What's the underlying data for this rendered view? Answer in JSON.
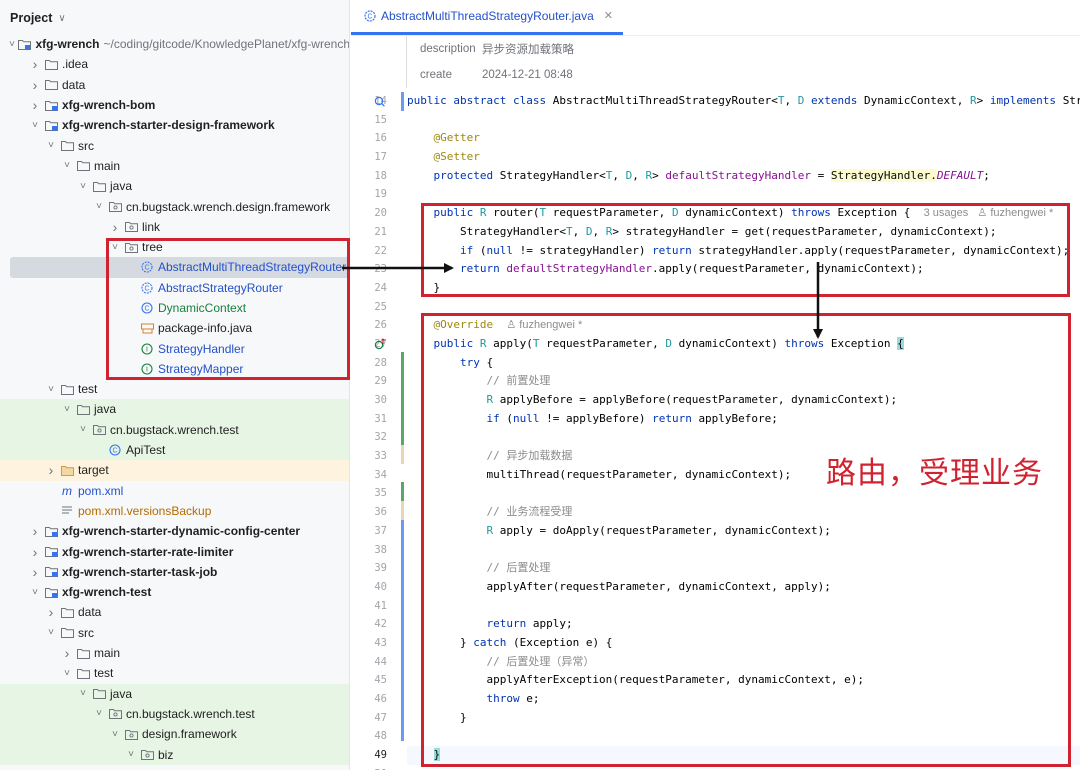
{
  "project": {
    "title": "Project",
    "tree": [
      {
        "indent": 0,
        "arrow": "down",
        "icon": "module-folder-icon",
        "label": "xfg-wrench",
        "bold": true,
        "path": "~/coding/gitcode/KnowledgePlanet/xfg-wrench"
      },
      {
        "indent": 1,
        "arrow": "right",
        "icon": "folder-icon",
        "label": ".idea"
      },
      {
        "indent": 1,
        "arrow": "right",
        "icon": "folder-icon",
        "label": "data"
      },
      {
        "indent": 1,
        "arrow": "right",
        "icon": "module-folder-icon",
        "label": "xfg-wrench-bom",
        "bold": true
      },
      {
        "indent": 1,
        "arrow": "down",
        "icon": "module-folder-icon",
        "label": "xfg-wrench-starter-design-framework",
        "bold": true
      },
      {
        "indent": 2,
        "arrow": "down",
        "icon": "folder-icon",
        "label": "src"
      },
      {
        "indent": 3,
        "arrow": "down",
        "icon": "folder-icon",
        "label": "main"
      },
      {
        "indent": 4,
        "arrow": "down",
        "icon": "folder-icon",
        "label": "java"
      },
      {
        "indent": 5,
        "arrow": "down",
        "icon": "package-icon",
        "label": "cn.bugstack.wrench.design.framework"
      },
      {
        "indent": 6,
        "arrow": "right",
        "icon": "package-icon",
        "label": "link"
      },
      {
        "indent": 6,
        "arrow": "down",
        "icon": "package-icon",
        "label": "tree"
      },
      {
        "indent": 7,
        "arrow": "",
        "icon": "abstract-class-icon",
        "label": "AbstractMultiThreadStrategyRouter",
        "color": "blue",
        "selected": true
      },
      {
        "indent": 7,
        "arrow": "",
        "icon": "abstract-class-icon",
        "label": "AbstractStrategyRouter",
        "color": "blue"
      },
      {
        "indent": 7,
        "arrow": "",
        "icon": "class-icon",
        "label": "DynamicContext",
        "color": "green"
      },
      {
        "indent": 7,
        "arrow": "",
        "icon": "package-info-icon",
        "label": "package-info.java"
      },
      {
        "indent": 7,
        "arrow": "",
        "icon": "interface-icon",
        "label": "StrategyHandler",
        "color": "blue"
      },
      {
        "indent": 7,
        "arrow": "",
        "icon": "interface-icon",
        "label": "StrategyMapper",
        "color": "blue"
      },
      {
        "indent": 2,
        "arrow": "down",
        "icon": "folder-icon",
        "label": "test"
      },
      {
        "indent": 3,
        "arrow": "down",
        "icon": "folder-icon",
        "label": "java",
        "hl": "green"
      },
      {
        "indent": 4,
        "arrow": "down",
        "icon": "package-icon",
        "label": "cn.bugstack.wrench.test",
        "hl": "green"
      },
      {
        "indent": 5,
        "arrow": "",
        "icon": "class-icon",
        "label": "ApiTest",
        "hl": "green"
      },
      {
        "indent": 2,
        "arrow": "right",
        "icon": "excluded-folder-icon",
        "label": "target",
        "hl": "yellow"
      },
      {
        "indent": 2,
        "arrow": "",
        "icon": "maven-icon",
        "label": "pom.xml",
        "color": "blue"
      },
      {
        "indent": 2,
        "arrow": "",
        "icon": "text-file-icon",
        "label": "pom.xml.versionsBackup",
        "color": "orange"
      },
      {
        "indent": 1,
        "arrow": "right",
        "icon": "module-folder-icon",
        "label": "xfg-wrench-starter-dynamic-config-center",
        "bold": true
      },
      {
        "indent": 1,
        "arrow": "right",
        "icon": "module-folder-icon",
        "label": "xfg-wrench-starter-rate-limiter",
        "bold": true
      },
      {
        "indent": 1,
        "arrow": "right",
        "icon": "module-folder-icon",
        "label": "xfg-wrench-starter-task-job",
        "bold": true
      },
      {
        "indent": 1,
        "arrow": "down",
        "icon": "module-folder-icon",
        "label": "xfg-wrench-test",
        "bold": true
      },
      {
        "indent": 2,
        "arrow": "right",
        "icon": "folder-icon",
        "label": "data"
      },
      {
        "indent": 2,
        "arrow": "down",
        "icon": "folder-icon",
        "label": "src"
      },
      {
        "indent": 3,
        "arrow": "right",
        "icon": "folder-icon",
        "label": "main"
      },
      {
        "indent": 3,
        "arrow": "down",
        "icon": "folder-icon",
        "label": "test"
      },
      {
        "indent": 4,
        "arrow": "down",
        "icon": "folder-icon",
        "label": "java",
        "hl": "green"
      },
      {
        "indent": 5,
        "arrow": "down",
        "icon": "package-icon",
        "label": "cn.bugstack.wrench.test",
        "hl": "green"
      },
      {
        "indent": 6,
        "arrow": "down",
        "icon": "package-icon",
        "label": "design.framework",
        "hl": "green"
      },
      {
        "indent": 7,
        "arrow": "down",
        "icon": "package-icon",
        "label": "biz",
        "hl": "green"
      }
    ]
  },
  "editor": {
    "tab_label": "AbstractMultiThreadStrategyRouter.java",
    "doc": [
      {
        "key": "description",
        "value": "异步资源加载策略"
      },
      {
        "key": "create",
        "value": "2024-12-21 08:48"
      }
    ],
    "current_line": 49,
    "lines": [
      {
        "n": 14,
        "g": "impl-icon",
        "seg": [
          [
            "kw",
            "public abstract class "
          ],
          [
            "ty",
            "AbstractMultiThreadStrategyRouter<"
          ],
          [
            "tp",
            "T"
          ],
          [
            "ty",
            ", "
          ],
          [
            "tp",
            "D"
          ],
          [
            "kw",
            " extends "
          ],
          [
            "ty",
            "DynamicContext, "
          ],
          [
            "tp",
            "R"
          ],
          [
            "ty",
            "> "
          ],
          [
            "kw",
            "implements "
          ],
          [
            "ty",
            "StrategyMapper"
          ]
        ]
      },
      {
        "n": 15,
        "seg": []
      },
      {
        "n": 16,
        "seg": [
          [
            "ty",
            "    "
          ],
          [
            "an",
            "@Getter"
          ]
        ]
      },
      {
        "n": 17,
        "seg": [
          [
            "ty",
            "    "
          ],
          [
            "an",
            "@Setter"
          ]
        ]
      },
      {
        "n": 18,
        "seg": [
          [
            "ty",
            "    "
          ],
          [
            "kw",
            "protected "
          ],
          [
            "ty",
            "StrategyHandler<"
          ],
          [
            "tp",
            "T"
          ],
          [
            "ty",
            ", "
          ],
          [
            "tp",
            "D"
          ],
          [
            "ty",
            ", "
          ],
          [
            "tp",
            "R"
          ],
          [
            "ty",
            "> "
          ],
          [
            "fld",
            "defaultStrategyHandler"
          ],
          [
            "ty",
            " = "
          ],
          [
            "hly",
            "StrategyHandler."
          ],
          [
            "st",
            "DEFAULT"
          ],
          [
            "ty",
            ";"
          ]
        ]
      },
      {
        "n": 19,
        "seg": []
      },
      {
        "n": 20,
        "seg": [
          [
            "ty",
            "    "
          ],
          [
            "kw",
            "public "
          ],
          [
            "tp",
            "R "
          ],
          [
            "ty",
            "router("
          ],
          [
            "tp",
            "T "
          ],
          [
            "ty",
            "requestParameter, "
          ],
          [
            "tp",
            "D "
          ],
          [
            "ty",
            "dynamicContext) "
          ],
          [
            "kw",
            "throws "
          ],
          [
            "ty",
            "Exception {  "
          ],
          [
            "hint",
            "3 usages   ♙ fuzhengwei *"
          ]
        ]
      },
      {
        "n": 21,
        "seg": [
          [
            "ty",
            "        StrategyHandler<"
          ],
          [
            "tp",
            "T"
          ],
          [
            "ty",
            ", "
          ],
          [
            "tp",
            "D"
          ],
          [
            "ty",
            ", "
          ],
          [
            "tp",
            "R"
          ],
          [
            "ty",
            "> strategyHandler = get(requestParameter, dynamicContext);"
          ]
        ]
      },
      {
        "n": 22,
        "seg": [
          [
            "ty",
            "        "
          ],
          [
            "kw",
            "if "
          ],
          [
            "ty",
            "("
          ],
          [
            "kw",
            "null "
          ],
          [
            "ty",
            "!= strategyHandler) "
          ],
          [
            "kw",
            "return "
          ],
          [
            "ty",
            "strategyHandler.apply(requestParameter, dynamicContext);"
          ]
        ]
      },
      {
        "n": 23,
        "seg": [
          [
            "ty",
            "        "
          ],
          [
            "kw",
            "return "
          ],
          [
            "fld",
            "defaultStrategyHandler"
          ],
          [
            "ty",
            ".apply(requestParameter, dynamicContext);"
          ]
        ]
      },
      {
        "n": 24,
        "seg": [
          [
            "ty",
            "    }"
          ]
        ]
      },
      {
        "n": 25,
        "seg": []
      },
      {
        "n": 26,
        "seg": [
          [
            "ty",
            "    "
          ],
          [
            "an",
            "@Override  "
          ],
          [
            "hint",
            "♙ fuzhengwei *"
          ]
        ]
      },
      {
        "n": 27,
        "g": "override-icon",
        "seg": [
          [
            "ty",
            "    "
          ],
          [
            "kw",
            "public "
          ],
          [
            "tp",
            "R "
          ],
          [
            "ty",
            "apply("
          ],
          [
            "tp",
            "T "
          ],
          [
            "ty",
            "requestParameter, "
          ],
          [
            "tp",
            "D "
          ],
          [
            "ty",
            "dynamicContext) "
          ],
          [
            "kw",
            "throws "
          ],
          [
            "ty",
            "Exception "
          ],
          [
            "brace",
            "{"
          ]
        ]
      },
      {
        "n": 28,
        "seg": [
          [
            "ty",
            "        "
          ],
          [
            "kw",
            "try "
          ],
          [
            "ty",
            "{"
          ]
        ]
      },
      {
        "n": 29,
        "seg": [
          [
            "ty",
            "            "
          ],
          [
            "cm",
            "// 前置处理"
          ]
        ]
      },
      {
        "n": 30,
        "seg": [
          [
            "ty",
            "            "
          ],
          [
            "tp",
            "R "
          ],
          [
            "ty",
            "applyBefore = applyBefore(requestParameter, dynamicContext);"
          ]
        ]
      },
      {
        "n": 31,
        "seg": [
          [
            "ty",
            "            "
          ],
          [
            "kw",
            "if "
          ],
          [
            "ty",
            "("
          ],
          [
            "kw",
            "null "
          ],
          [
            "ty",
            "!= applyBefore) "
          ],
          [
            "kw",
            "return "
          ],
          [
            "ty",
            "applyBefore;"
          ]
        ]
      },
      {
        "n": 32,
        "seg": []
      },
      {
        "n": 33,
        "seg": [
          [
            "ty",
            "            "
          ],
          [
            "cm",
            "// 异步加载数据"
          ]
        ]
      },
      {
        "n": 34,
        "seg": [
          [
            "ty",
            "            multiThread(requestParameter, dynamicContext);"
          ]
        ]
      },
      {
        "n": 35,
        "seg": []
      },
      {
        "n": 36,
        "seg": [
          [
            "ty",
            "            "
          ],
          [
            "cm",
            "// 业务流程受理"
          ]
        ]
      },
      {
        "n": 37,
        "seg": [
          [
            "ty",
            "            "
          ],
          [
            "tp",
            "R "
          ],
          [
            "ty",
            "apply = doApply(requestParameter, dynamicContext);"
          ]
        ]
      },
      {
        "n": 38,
        "seg": []
      },
      {
        "n": 39,
        "seg": [
          [
            "ty",
            "            "
          ],
          [
            "cm",
            "// 后置处理"
          ]
        ]
      },
      {
        "n": 40,
        "seg": [
          [
            "ty",
            "            applyAfter(requestParameter, dynamicContext, apply);"
          ]
        ]
      },
      {
        "n": 41,
        "seg": []
      },
      {
        "n": 42,
        "seg": [
          [
            "ty",
            "            "
          ],
          [
            "kw",
            "return "
          ],
          [
            "ty",
            "apply;"
          ]
        ]
      },
      {
        "n": 43,
        "seg": [
          [
            "ty",
            "        } "
          ],
          [
            "kw",
            "catch "
          ],
          [
            "ty",
            "(Exception e) {"
          ]
        ]
      },
      {
        "n": 44,
        "seg": [
          [
            "ty",
            "            "
          ],
          [
            "cm",
            "// 后置处理（异常）"
          ]
        ]
      },
      {
        "n": 45,
        "seg": [
          [
            "ty",
            "            applyAfterException(requestParameter, dynamicContext, e);"
          ]
        ]
      },
      {
        "n": 46,
        "seg": [
          [
            "ty",
            "            "
          ],
          [
            "kw",
            "throw "
          ],
          [
            "ty",
            "e;"
          ]
        ]
      },
      {
        "n": 47,
        "seg": [
          [
            "ty",
            "        }"
          ]
        ]
      },
      {
        "n": 48,
        "seg": []
      },
      {
        "n": 49,
        "seg": [
          [
            "ty",
            "    "
          ],
          [
            "brace",
            "}"
          ]
        ]
      },
      {
        "n": 50,
        "seg": []
      }
    ]
  },
  "annotation": {
    "text": "路由，受理业务",
    "color": "#d0222f"
  },
  "colors": {
    "accent": "#3574f0",
    "highlight_red": "#d0222f",
    "vcs_added_green": "#59a869",
    "vcs_modified_blue": "#6b9bf0",
    "vcs_modified_tan": "#e8d7b6"
  }
}
